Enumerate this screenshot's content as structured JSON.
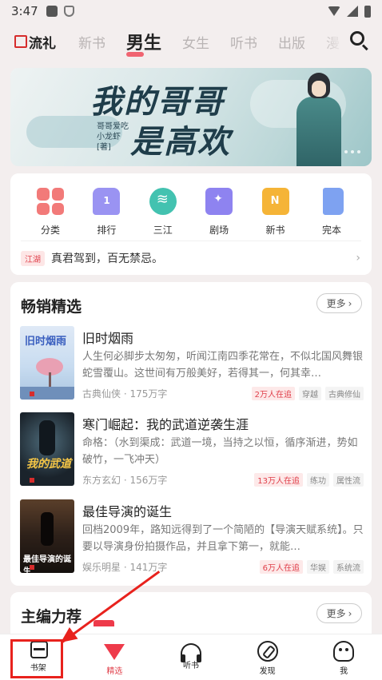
{
  "status_bar": {
    "time": "3:47"
  },
  "top_nav": {
    "logo": "流礼",
    "tabs": [
      {
        "label": "新书",
        "active": false
      },
      {
        "label": "男生",
        "active": true
      },
      {
        "label": "女生",
        "active": false
      },
      {
        "label": "听书",
        "active": false
      },
      {
        "label": "出版",
        "active": false
      },
      {
        "label": "漫",
        "active": false
      }
    ]
  },
  "banner": {
    "title_line1": "我的哥哥",
    "title_line2": "是高欢",
    "author": "哥哥爱吃小龙虾 [著]"
  },
  "categories": [
    {
      "label": "分类",
      "icon": "grid-icon"
    },
    {
      "label": "排行",
      "icon": "rank-icon"
    },
    {
      "label": "三江",
      "icon": "wave-icon"
    },
    {
      "label": "剧场",
      "icon": "theater-icon"
    },
    {
      "label": "新书",
      "icon": "new-book-icon"
    },
    {
      "label": "完本",
      "icon": "book-icon"
    }
  ],
  "ticker": {
    "badge": "江湖",
    "text": "真君驾到，百无禁忌。"
  },
  "bestseller": {
    "title": "畅销精选",
    "more": "更多",
    "books": [
      {
        "title": "旧时烟雨",
        "desc": "人生何必脚步太匆匆，听闻江南四季花常在，不似北国风舞银蛇雪覆山。这世间有万般美好，若得其一，何其幸…",
        "genre": "古典仙侠",
        "words": "175万字",
        "tags": [
          "2万人在追",
          "穿越",
          "古典修仙"
        ],
        "cover_text": "旧时烟雨"
      },
      {
        "title": "寒门崛起：我的武道逆袭生涯",
        "desc": "命格：（水到渠成：武道一境，当持之以恒，循序渐进，势如破竹，一飞冲天）",
        "genre": "东方玄幻",
        "words": "156万字",
        "tags": [
          "13万人在追",
          "练功",
          "属性流"
        ],
        "cover_text": "我的武道"
      },
      {
        "title": "最佳导演的诞生",
        "desc": "回档2009年，路知远得到了一个简陋的【导演天赋系统】。只要以导演身份拍摄作品，并且拿下第一，就能…",
        "genre": "娱乐明星",
        "words": "141万字",
        "tags": [
          "6万人在追",
          "华娱",
          "系统流"
        ],
        "cover_text": "最佳导演的诞生"
      }
    ]
  },
  "recommend": {
    "title": "主编力荐",
    "more": "更多"
  },
  "bottom_bar": [
    {
      "label": "书架",
      "icon": "bookshelf-icon",
      "active": false
    },
    {
      "label": "精选",
      "icon": "featured-icon",
      "active": true
    },
    {
      "label": "听书",
      "icon": "headphones-icon",
      "active": false
    },
    {
      "label": "发现",
      "icon": "compass-icon",
      "active": false
    },
    {
      "label": "我",
      "icon": "profile-icon",
      "active": false
    }
  ],
  "annotation_color": "#e8221d"
}
